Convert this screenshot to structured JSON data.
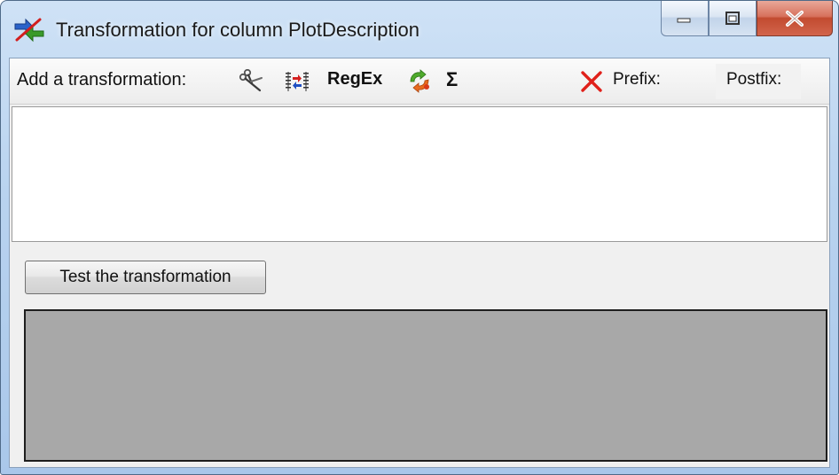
{
  "window": {
    "title": "Transformation for column PlotDescription",
    "app_icon": "transform-app-icon",
    "caption_buttons": {
      "minimize": "minimize-icon",
      "maximize": "maximize-icon",
      "close": "close-icon"
    }
  },
  "toolbar": {
    "label": "Add a transformation:",
    "tools": [
      {
        "name": "split",
        "icon": "scissors-icon"
      },
      {
        "name": "columns",
        "icon": "merge-columns-icon"
      },
      {
        "name": "regex",
        "text": "RegEx"
      },
      {
        "name": "replace",
        "icon": "replace-arrows-icon"
      },
      {
        "name": "sum",
        "text": "Σ"
      }
    ],
    "remove_icon": "red-x-icon",
    "prefix_label": "Prefix:",
    "postfix_label": "Postfix:"
  },
  "transformation_list": {
    "items": []
  },
  "test_button": {
    "label": "Test the transformation"
  },
  "result_panel": {
    "content": ""
  },
  "colors": {
    "titlebar": "#b9d3ef",
    "client_bg": "#f0f0f0",
    "result_bg": "#a8a8a8",
    "close_button": "#c24b30",
    "remove_x": "#e0201a"
  }
}
